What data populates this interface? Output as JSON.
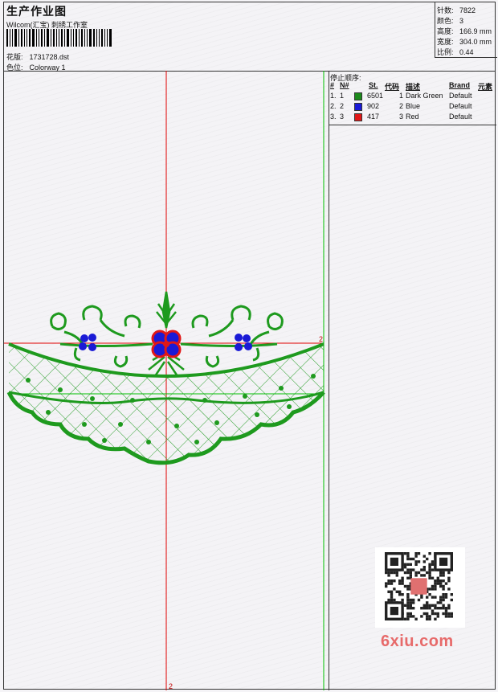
{
  "header": {
    "title": "生产作业图",
    "company": "Wilcom(汇宝) 刺绣工作室",
    "design_label": "花版:",
    "design_file": "1731728.dst",
    "colorway_label": "色位:",
    "colorway": "Colorway 1"
  },
  "stats": [
    {
      "label": "针数:",
      "value": "7822"
    },
    {
      "label": "颜色:",
      "value": "3"
    },
    {
      "label": "高度:",
      "value": "166.9 mm"
    },
    {
      "label": "宽度:",
      "value": "304.0 mm"
    },
    {
      "label": "比例:",
      "value": "0.44"
    }
  ],
  "sequence": {
    "title": "停止顺序:",
    "headers": {
      "hash": "#",
      "n": "N#",
      "st": "St.",
      "code": "代码",
      "desc": "描述",
      "brand": "Brand",
      "elem": "元素"
    },
    "rows": [
      {
        "hash": "1.",
        "n": "1",
        "color": "#1c8a1c",
        "st": "6501",
        "code": "1",
        "desc": "Dark Green",
        "brand": "Default"
      },
      {
        "hash": "2.",
        "n": "2",
        "color": "#1a1ad6",
        "st": "902",
        "code": "2",
        "desc": "Blue",
        "brand": "Default"
      },
      {
        "hash": "3.",
        "n": "3",
        "color": "#e01818",
        "st": "417",
        "code": "3",
        "desc": "Red",
        "brand": "Default"
      }
    ]
  },
  "canvas": {
    "marker_bottom": "2",
    "marker_right": "2"
  },
  "watermark": "6xiu.com",
  "colors": {
    "thread_green": "#1e9a1e",
    "thread_blue": "#1a1ad6",
    "thread_red": "#e01818",
    "guide_red": "#e00000",
    "guide_green": "#00c000"
  }
}
